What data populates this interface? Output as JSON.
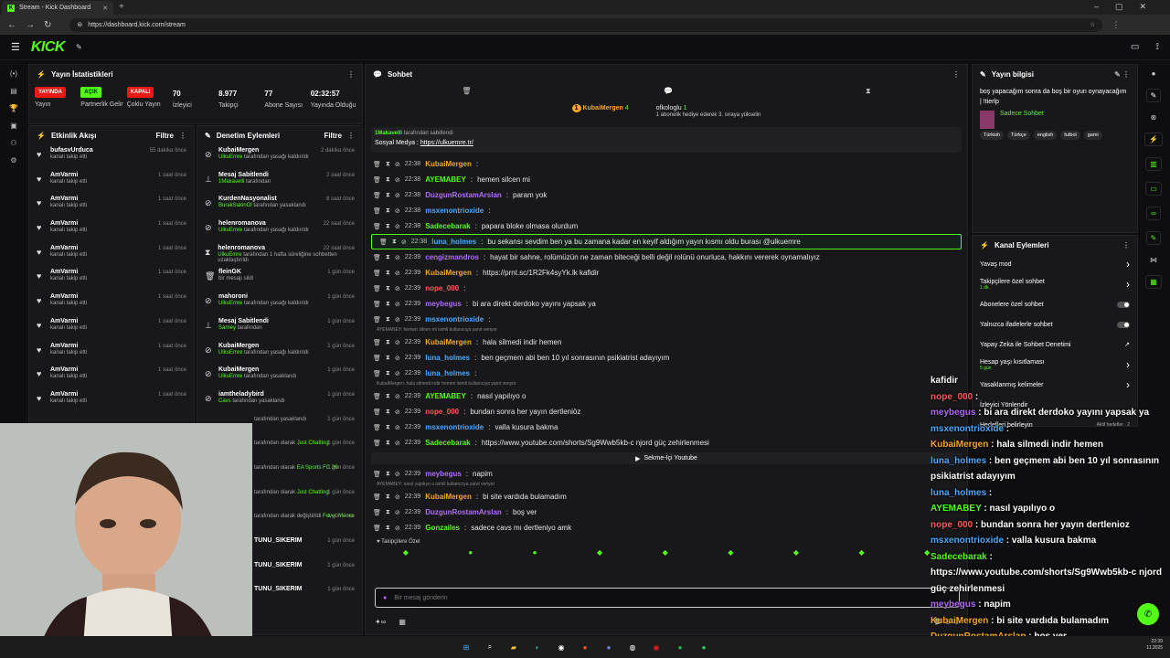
{
  "browser": {
    "tab_title": "Stream - Kick Dashboard",
    "url": "https://dashboard.kick.com/stream"
  },
  "logo": "KICK",
  "stats": {
    "title": "Yayın İstatistikleri",
    "items": [
      {
        "pill": "YAYINDA",
        "pill_color": "#e91916",
        "label": "Yayın"
      },
      {
        "pill": "AÇIK",
        "pill_color": "#53fc18",
        "label": "Partnerlik Gelir"
      },
      {
        "pill": "KAPALI",
        "pill_color": "#e91916",
        "label": "Çoklu Yayın"
      },
      {
        "value": "70",
        "label": "İzleyici"
      },
      {
        "value": "8.977",
        "label": "Takipçi"
      },
      {
        "value": "77",
        "label": "Abone Sayısı"
      },
      {
        "value": "02:32:57",
        "label": "Yayında Olduğu"
      }
    ]
  },
  "activity": {
    "title": "Etkinlik Akışı",
    "filter": "Filtre",
    "items": [
      {
        "name": "bufasvUrduca",
        "sub": "kanalı takip etti",
        "time": "55 dakika önce"
      },
      {
        "name": "AmVarmi",
        "sub": "kanalı takip etti",
        "time": "1 saat önce"
      },
      {
        "name": "AmVarmi",
        "sub": "kanalı takip etti",
        "time": "1 saat önce"
      },
      {
        "name": "AmVarmi",
        "sub": "kanalı takip etti",
        "time": "1 saat önce"
      },
      {
        "name": "AmVarmi",
        "sub": "kanalı takip etti",
        "time": "1 saat önce"
      },
      {
        "name": "AmVarmi",
        "sub": "kanalı takip etti",
        "time": "1 saat önce"
      },
      {
        "name": "AmVarmi",
        "sub": "kanalı takip etti",
        "time": "1 saat önce"
      },
      {
        "name": "AmVarmi",
        "sub": "kanalı takip etti",
        "time": "1 saat önce"
      },
      {
        "name": "AmVarmi",
        "sub": "kanalı takip etti",
        "time": "1 saat önce"
      },
      {
        "name": "AmVarmi",
        "sub": "kanalı takip etti",
        "time": "1 saat önce"
      },
      {
        "name": "AmVarmi",
        "sub": "kanalı takip etti",
        "time": "1 saat önce"
      }
    ]
  },
  "moderation": {
    "title": "Denetim Eylemleri",
    "filter": "Filtre",
    "items": [
      {
        "icon": "⊘",
        "name": "KubaiMergen",
        "actor": "UlkuEmre",
        "sub": "tarafından yasağı kaldırıldı",
        "time": "2 dakika önce"
      },
      {
        "icon": "⊥",
        "name": "Mesaj Sabitlendi",
        "actor": "1Makavelli",
        "sub": "tarafından",
        "time": "2 saat önce"
      },
      {
        "icon": "⊘",
        "name": "KurdenNasyonalist",
        "actor": "BurakSakinOl",
        "sub": "tarafından yasaklandı",
        "time": "8 saat önce"
      },
      {
        "icon": "⊘",
        "name": "helenromanova",
        "actor": "UlkuEmre",
        "sub": "tarafından yasağı kaldırıldı",
        "time": "22 saat önce"
      },
      {
        "icon": "⧗",
        "name": "helenromanova",
        "actor": "UlkuEmre",
        "sub": "tarafından 1 hafta süreliğine sohbetten uzaklaştırıldı",
        "time": "22 saat önce"
      },
      {
        "icon": "🗑",
        "name": "fleinGK",
        "actor": "",
        "sub": "bir mesajı sildi",
        "time": "1 gün önce"
      },
      {
        "icon": "⊘",
        "name": "mahoroni",
        "actor": "UlkuEmre",
        "sub": "tarafından yasağı kaldırıldı",
        "time": "1 gün önce"
      },
      {
        "icon": "⊥",
        "name": "Mesaj Sabitlendi",
        "actor": "Sarney",
        "sub": "tarafından",
        "time": "1 gün önce"
      },
      {
        "icon": "⊘",
        "name": "KubaiMergen",
        "actor": "UlkuEmre",
        "sub": "tarafından yasağı kaldırıldı",
        "time": "1 gün önce"
      },
      {
        "icon": "⊘",
        "name": "KubaiMergen",
        "actor": "UlkuEmre",
        "sub": "tarafından yasaklandı",
        "time": "1 gün önce"
      },
      {
        "icon": "⊘",
        "name": "iamtheladybird",
        "actor": "Cavs",
        "sub": "tarafından yasaklandı",
        "time": "1 gün önce"
      }
    ],
    "partial": [
      {
        "name": "",
        "actor": "",
        "sub": "tarafından yasaklandı",
        "time": "1 gün önce"
      },
      {
        "name": "",
        "actor": "Just Chatting",
        "sub": "tarafından olarak",
        "time": "1 gün önce"
      },
      {
        "name": "",
        "actor": "EA Sports FC 26",
        "sub": "tarafından olarak",
        "time": "1 gün önce"
      },
      {
        "name": "",
        "actor": "Just Chatting",
        "sub": "tarafından olarak",
        "time": "1 gün önce"
      },
      {
        "name": "",
        "actor": "Fever Memo",
        "sub": "tarafından olarak değiştirildi",
        "time": "1 gün önce"
      },
      {
        "name": "TUNU_SIKERIM",
        "actor": "",
        "sub": "",
        "time": "1 gün önce"
      },
      {
        "name": "TUNU_SIKERIM",
        "actor": "",
        "sub": "",
        "time": "1 gün önce"
      },
      {
        "name": "TUNU_SIKERIM",
        "actor": "",
        "sub": "",
        "time": "1 gün önce"
      }
    ]
  },
  "chat": {
    "title": "Sohbet",
    "sub_user": "KubaiMergen",
    "sub_user_count": "4",
    "sub_target": "ofkologlu",
    "sub_count": "1",
    "sub_note": "1 abonelik hediye ederek 3. sıraya yükselin",
    "pinned_by": "1Makavelli",
    "pinned_suffix": "tarafından sabitlendi",
    "pinned_label": "Sosyal Medya :",
    "pinned_link": "https://ulkuemre.tr/",
    "messages": [
      {
        "time": "22:38",
        "user": "KubaiMergen",
        "color": "#f5a623",
        "text": ""
      },
      {
        "time": "22:38",
        "user": "AYEMABEY",
        "color": "#53fc18",
        "text": "hemen silcen mi"
      },
      {
        "time": "22:38",
        "user": "DuzgunRostamArslan",
        "color": "#b06cf5",
        "text": "param yok"
      },
      {
        "time": "22:38",
        "user": "msxenontrioxide",
        "color": "#4aa8ff",
        "text": ""
      },
      {
        "time": "22:38",
        "user": "Sadecebarak",
        "color": "#53fc18",
        "text": "papara bloke olmasa olurdum"
      },
      {
        "time": "22:38",
        "user": "luna_holmes",
        "color": "#4aa8ff",
        "text": "bu sekansı sevdim ben ya bu zamana kadar en keyif aldığım yayın kısmı oldu burası @ulkuemre",
        "hl": true
      },
      {
        "time": "22:39",
        "user": "cengizmandros",
        "color": "#b06cf5",
        "text": "hayat bir sahne, rolümüzün ne zaman biteceği belli değil rolünü onurluca, hakkını vererek oynamalıyız"
      },
      {
        "time": "22:39",
        "user": "KubaiMergen",
        "color": "#f5a623",
        "text": "https://prnt.sc/1R2Fk4syYk.lk kafidir"
      },
      {
        "time": "22:39",
        "user": "nope_000",
        "color": "#ff5a5a",
        "text": ""
      },
      {
        "time": "22:39",
        "user": "meybegus",
        "color": "#b06cf5",
        "text": "bi ara direkt derdoko yayını yapsak ya"
      },
      {
        "time": "22:39",
        "user": "msxenontrioxide",
        "color": "#4aa8ff",
        "text": ""
      },
      {
        "time": "22:39",
        "user": "KubaiMergen",
        "color": "#f5a623",
        "text": "hala silmedi indir hemen",
        "reply": "AYEMABEY: hemen silcen mi isimli kullanıcıya yanıt veriyor"
      },
      {
        "time": "22:39",
        "user": "luna_holmes",
        "color": "#4aa8ff",
        "text": "ben geçmem abi ben 10 yıl sonrasının psikiatrist adayıyım"
      },
      {
        "time": "22:39",
        "user": "luna_holmes",
        "color": "#4aa8ff",
        "text": ""
      },
      {
        "time": "22:39",
        "user": "AYEMABEY",
        "color": "#53fc18",
        "text": "nasıl yapılıyo o",
        "reply": "KubaiMergen: hala silmedi indir hemen isimli kullanıcıya yanıt veriyor"
      },
      {
        "time": "22:39",
        "user": "nope_000",
        "color": "#ff5a5a",
        "text": "bundan sonra her yayın dertleniöz"
      },
      {
        "time": "22:39",
        "user": "msxenontrioxide",
        "color": "#4aa8ff",
        "text": "valla kusura bakma"
      },
      {
        "time": "22:39",
        "user": "Sadecebarak",
        "color": "#53fc18",
        "text": "https://www.youtube.com/shorts/Sg9Wwb5kb-c njord güç zehirlenmesi"
      }
    ],
    "yt_banner": "Sekme-İçi Youtube",
    "messages2": [
      {
        "time": "22:39",
        "user": "meybegus",
        "color": "#b06cf5",
        "text": "napim",
        "reply": ""
      },
      {
        "time": "22:39",
        "user": "KubaiMergen",
        "color": "#f5a623",
        "text": "bi site vardıda bulamadım",
        "reply": "AYEMABEY: nasıl yapılıyo o isimli kullanıcıya yanıt veriyor"
      },
      {
        "time": "22:39",
        "user": "DuzgunRostamArslan",
        "color": "#b06cf5",
        "text": "boş ver"
      },
      {
        "time": "22:39",
        "user": "Gonzailes",
        "color": "#53fc18",
        "text": "sadece cavs mı dertleniyo amk"
      }
    ],
    "followers_only": "Takipçilere Özel",
    "placeholder": "Bir mesaj gönderin"
  },
  "info": {
    "title": "Yayın bilgisi",
    "desc": "boş yapacağım sonra da boş bir oyun oynayacağım | !tierlp",
    "category": "Sadece Sohbet",
    "tags": [
      "Türkish",
      "Türkçe",
      "english",
      "futbol",
      "gami"
    ]
  },
  "channel_actions": {
    "title": "Kanal Eylemleri",
    "items": [
      {
        "label": "Yavaş mod",
        "sub": "",
        "kind": "arrow"
      },
      {
        "label": "Takipçilere özel sohbet",
        "sub": "1 dk.",
        "kind": "arrow"
      },
      {
        "label": "Abonelere özel sohbet",
        "sub": "",
        "kind": "toggle"
      },
      {
        "label": "Yalnızca ifadelerle sohbet",
        "sub": "",
        "kind": "toggle"
      },
      {
        "label": "Yapay Zeka ile Sohbet Denetimi",
        "sub": "",
        "kind": "ext"
      },
      {
        "label": "Hesap yaşı kısıtlaması",
        "sub": "5 gün",
        "kind": "arrow"
      },
      {
        "label": "Yasaklanmış kelimeler",
        "sub": "",
        "kind": "arrow"
      },
      {
        "label": "İzleyici Yönlendir",
        "sub": "",
        "kind": "none"
      }
    ],
    "goals": "Hedefleri belirleyin",
    "active_goals": "Aktif hedefler · 2"
  },
  "overlay": [
    {
      "user": "",
      "color": "#fff",
      "text": "kafidir"
    },
    {
      "user": "nope_000",
      "color": "#ff5a5a",
      "text": ""
    },
    {
      "user": "meybegus",
      "color": "#b06cf5",
      "text": "bi ara direkt derdoko yayını yapsak ya"
    },
    {
      "user": "msxenontrioxide",
      "color": "#4aa8ff",
      "text": ""
    },
    {
      "user": "KubaiMergen",
      "color": "#f5a623",
      "text": "hala silmedi indir hemen"
    },
    {
      "user": "luna_holmes",
      "color": "#4aa8ff",
      "text": "ben geçmem abi ben 10 yıl sonrasının psikiatrist adayıyım"
    },
    {
      "user": "luna_holmes",
      "color": "#4aa8ff",
      "text": ""
    },
    {
      "user": "AYEMABEY",
      "color": "#53fc18",
      "text": "nasıl yapılıyo o"
    },
    {
      "user": "nope_000",
      "color": "#ff5a5a",
      "text": "bundan sonra her yayın dertlenioz"
    },
    {
      "user": "msxenontrioxide",
      "color": "#4aa8ff",
      "text": "valla kusura bakma"
    },
    {
      "user": "Sadecebarak",
      "color": "#53fc18",
      "text": "https://www.youtube.com/shorts/Sg9Wwb5kb-c njord güç zehirlenmesi"
    },
    {
      "user": "meybegus",
      "color": "#b06cf5",
      "text": "napim"
    },
    {
      "user": "KubaiMergen",
      "color": "#f5a623",
      "text": "bi site vardıda bulamadım"
    },
    {
      "user": "DuzgunRostamArslan",
      "color": "#f5a623",
      "text": "boş ver"
    },
    {
      "user": "Gonzailes",
      "color": "#53fc18",
      "text": "sadece cavs mı dertleniyo amk"
    }
  ],
  "clock": {
    "time": "22:39",
    "date": "11.2025"
  }
}
